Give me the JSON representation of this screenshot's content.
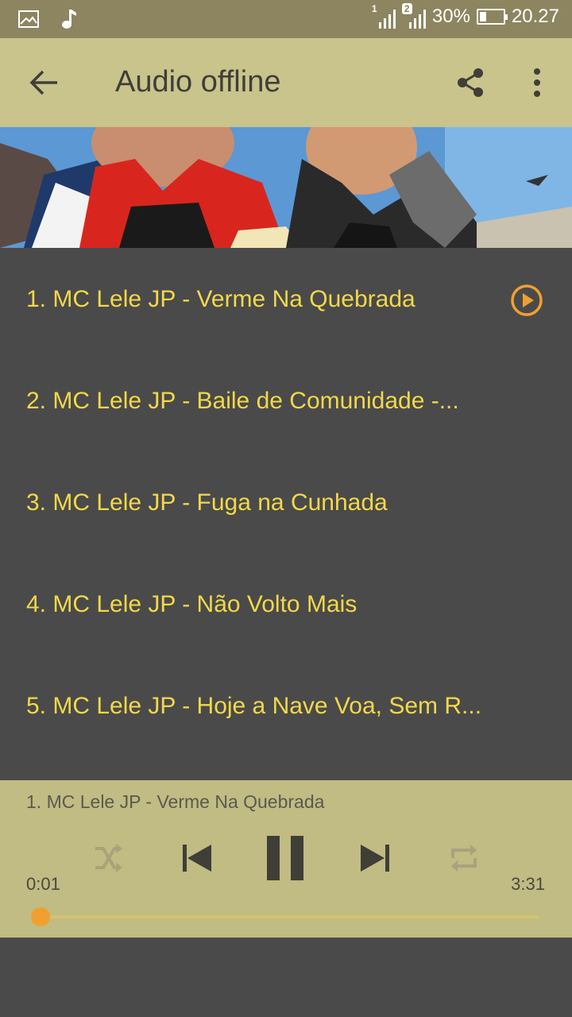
{
  "status_bar": {
    "sim1_tag": "1",
    "sim2_tag": "2",
    "battery": "30%",
    "battery_level": 0.3,
    "time": "20.27",
    "icons": [
      "image-icon",
      "music-note-icon",
      "signal-icon",
      "battery-icon"
    ]
  },
  "app_bar": {
    "title": "Audio offline",
    "icons": [
      "back-arrow-icon",
      "share-icon",
      "more-vert-icon"
    ]
  },
  "tracks": [
    {
      "title": "1. MC Lele JP - Verme Na Quebrada",
      "playing": true
    },
    {
      "title": "2. MC Lele JP - Baile de Comunidade -...",
      "playing": false
    },
    {
      "title": "3. MC Lele JP - Fuga na Cunhada",
      "playing": false
    },
    {
      "title": "4. MC Lele JP - Não Volto Mais",
      "playing": false
    },
    {
      "title": "5. MC Lele JP - Hoje a Nave Voa, Sem R...",
      "playing": false
    }
  ],
  "player": {
    "now_playing": "1. MC Lele JP - Verme Na Quebrada",
    "elapsed": "0:01",
    "duration": "3:31",
    "progress": 0.005,
    "icons": [
      "shuffle-icon",
      "previous-icon",
      "pause-icon",
      "next-icon",
      "repeat-icon"
    ]
  },
  "colors": {
    "status_bar": "#8c8560",
    "app_bar": "#c9c38c",
    "list_background": "#4a4a4a",
    "track_text": "#f2d84a",
    "accent": "#f0a030",
    "player_background": "#c1bb84"
  }
}
